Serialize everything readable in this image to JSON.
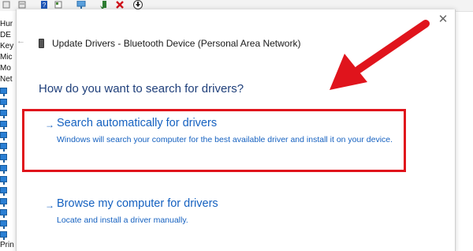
{
  "dialog": {
    "title": "Update Drivers - Bluetooth Device (Personal Area Network)",
    "question": "How do you want to search for drivers?",
    "back_icon": "back-arrow-icon",
    "close_icon": "close-icon",
    "options": [
      {
        "arrow": "→",
        "title": "Search automatically for drivers",
        "description": "Windows will search your computer for the best available driver and install it on your device."
      },
      {
        "arrow": "→",
        "title": "Browse my computer for drivers",
        "description": "Locate and install a driver manually."
      }
    ]
  },
  "background": {
    "tree_labels": [
      "Hur",
      "DE",
      "Key",
      "Mic",
      "Mo",
      "Net",
      "",
      "",
      "",
      "",
      "",
      "",
      "",
      "",
      "",
      "",
      "",
      "",
      "",
      "",
      "Prin"
    ],
    "toolbar_icons": [
      "properties-icon",
      "help-icon",
      "view-icon",
      "monitor-icon",
      "update-driver-icon",
      "uninstall-icon",
      "download-icon"
    ]
  },
  "annotation": {
    "highlight_color": "#e0141c",
    "arrow_color": "#e0141c"
  },
  "colors": {
    "link_blue": "#1561c0",
    "heading_blue": "#1f3f7a"
  }
}
